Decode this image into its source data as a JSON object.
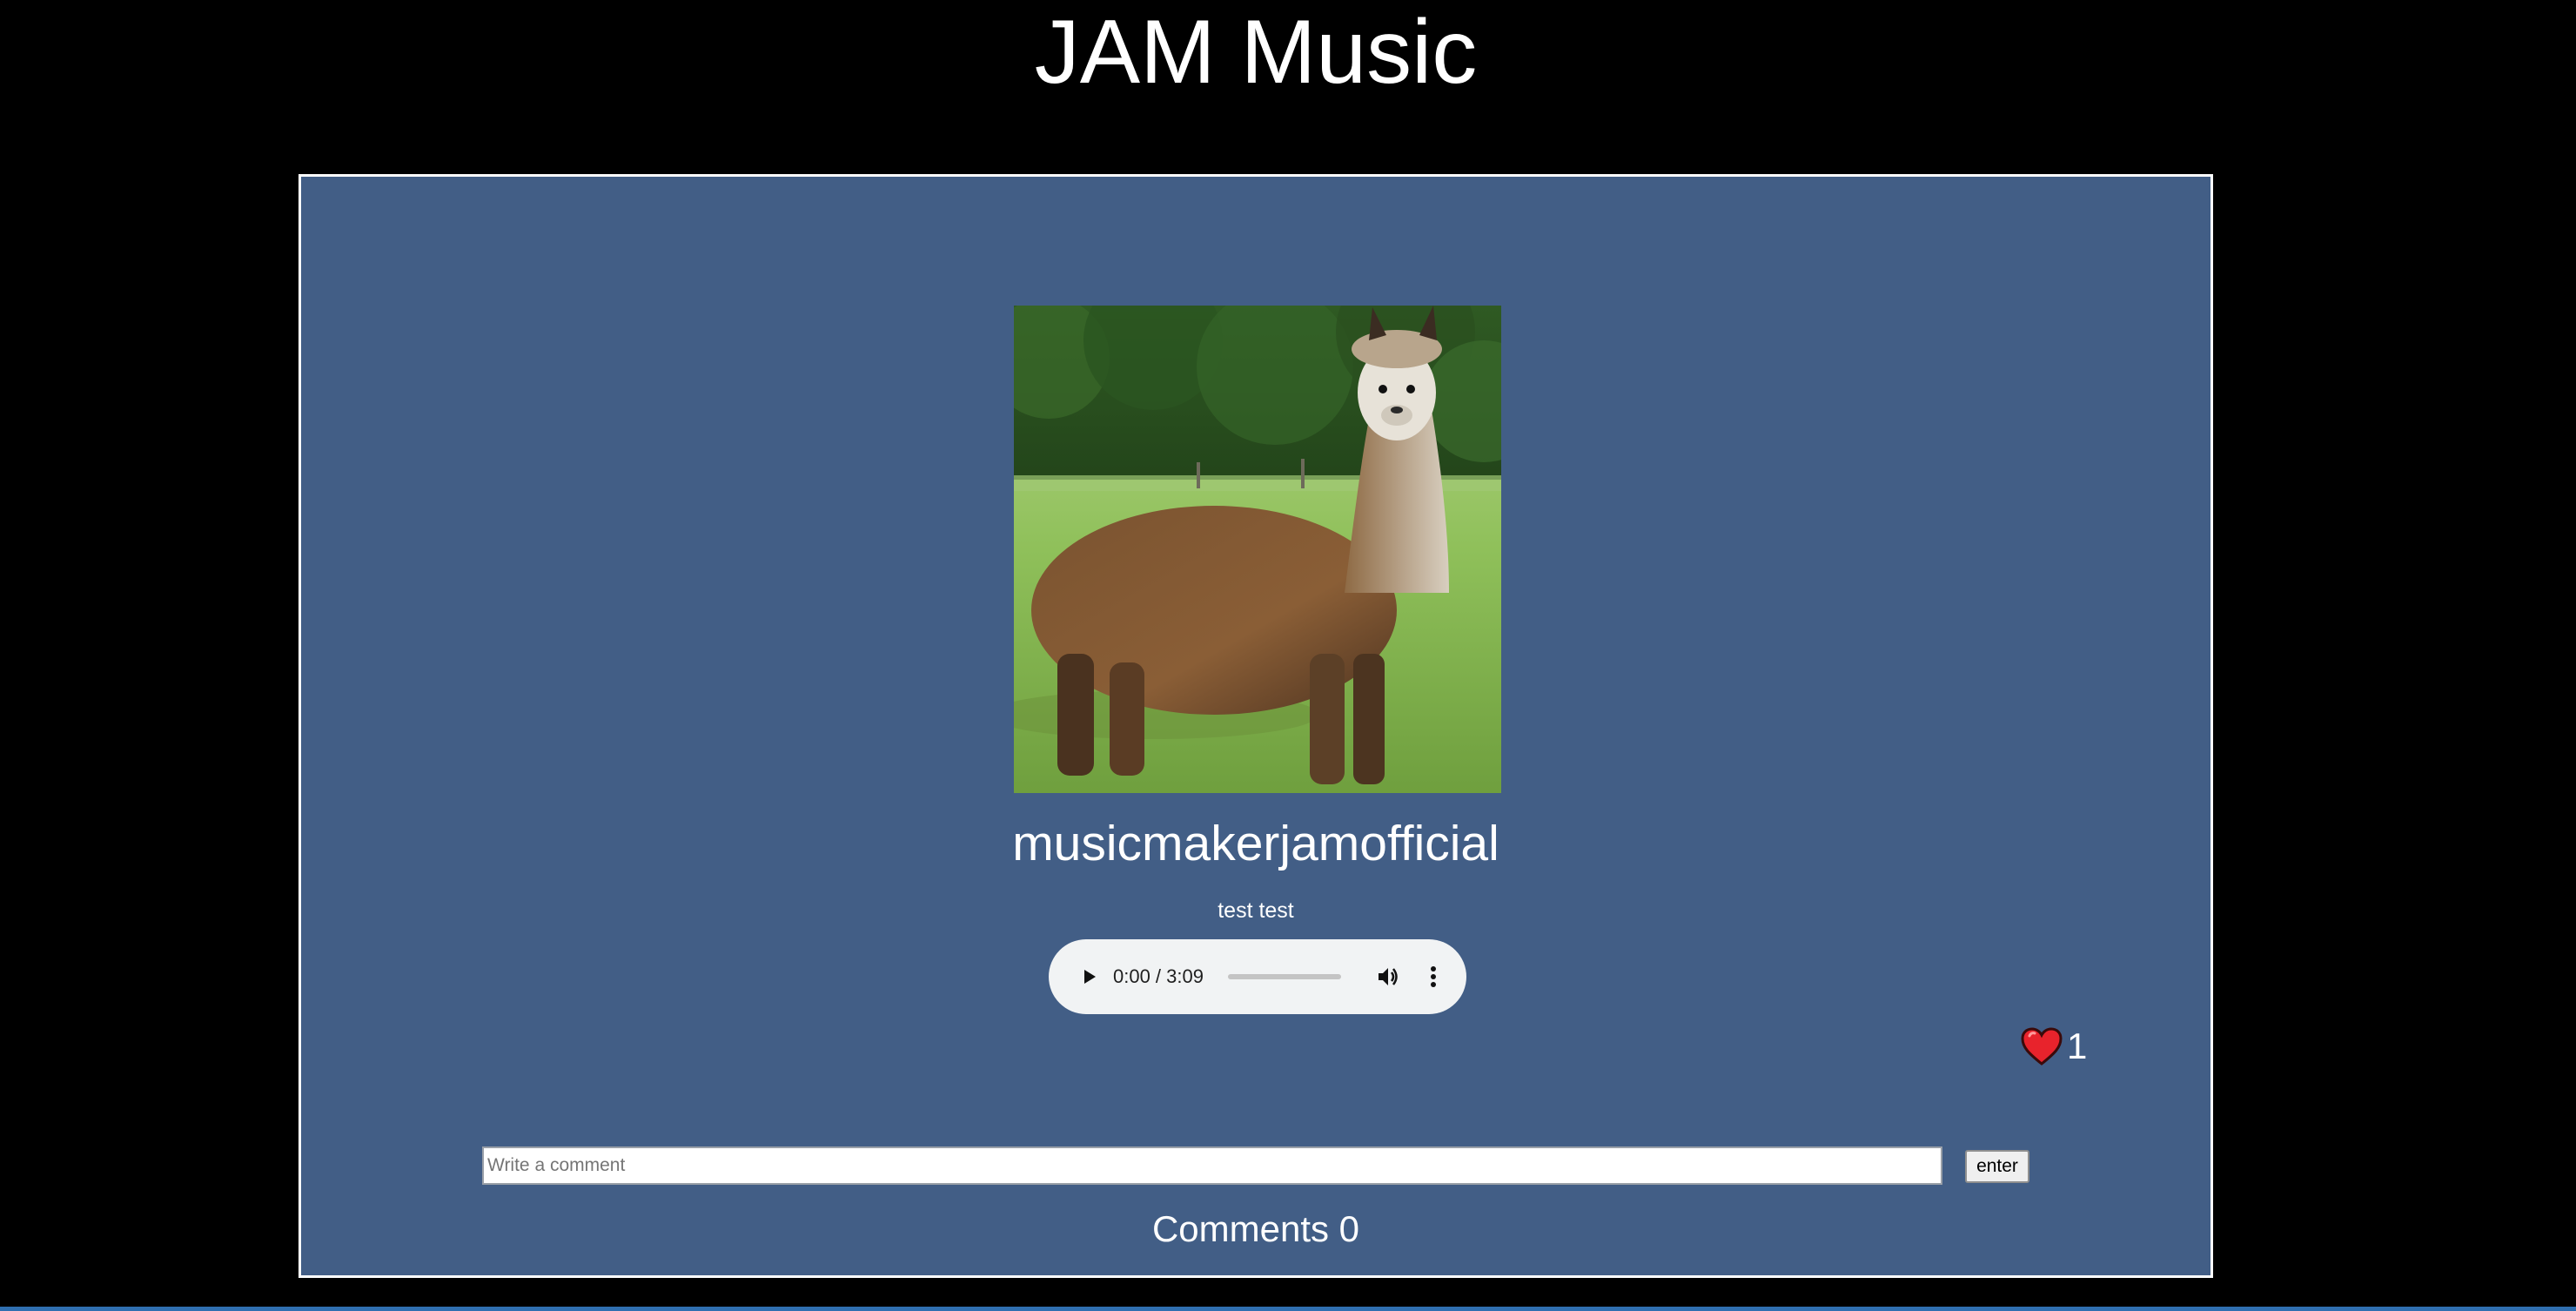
{
  "header": {
    "title": "JAM Music"
  },
  "post": {
    "cover_alt": "alpaca",
    "username": "musicmakerjamofficial",
    "song_title": "test test",
    "player": {
      "time": "0:00 / 3:09",
      "progress": 0
    },
    "likes": {
      "count": "1"
    },
    "comment_form": {
      "placeholder": "Write a comment",
      "value": "",
      "submit_label": "enter"
    },
    "comments": {
      "heading": "Comments 0"
    }
  },
  "icons": {
    "play": "play-icon",
    "volume": "volume-icon",
    "more": "more-vert-icon",
    "like": "heart-icon"
  },
  "colors": {
    "background": "#000000",
    "card": "#425e86",
    "card_border": "#ffffff",
    "heart": "#e8232c"
  }
}
